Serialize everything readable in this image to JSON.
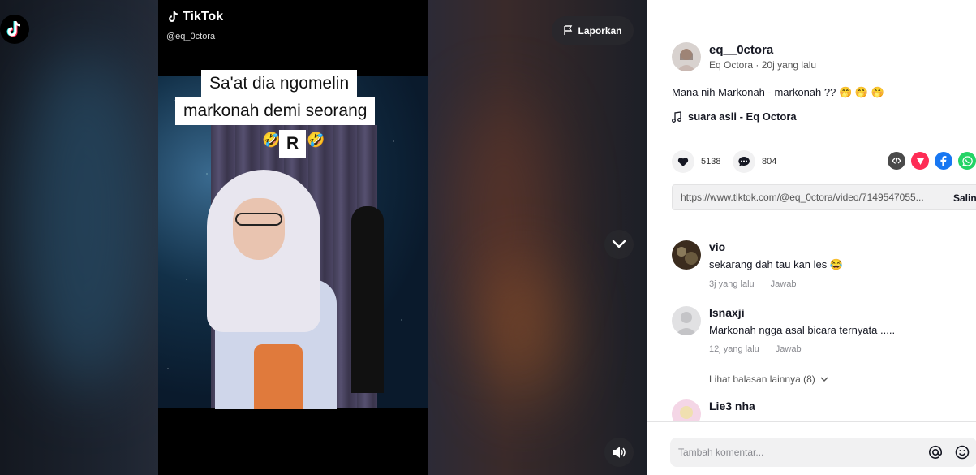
{
  "brand": {
    "name": "TikTok",
    "icon": "tiktok-logo-icon"
  },
  "video": {
    "watermark_brand": "TikTok",
    "watermark_handle": "@eq_0ctora",
    "caption_lines": [
      "Sa'at dia ngomelin",
      "markonah demi seorang",
      "R"
    ],
    "caption_emoji": "🤣",
    "report_label": "Laporkan"
  },
  "post": {
    "username": "eq__0ctora",
    "display_name": "Eq Octora",
    "time": "20j yang lalu",
    "description": "Mana nih Markonah - markonah ??",
    "description_emoji": "🤭 🤭 🤭",
    "music": "suara asli - Eq Octora",
    "likes": "5138",
    "comments_count": "804",
    "link": "https://www.tiktok.com/@eq_0ctora/video/7149547055...",
    "copy_label": "Salin"
  },
  "comments": [
    {
      "name": "vio",
      "text": "sekarang dah tau kan les",
      "emoji": "😂",
      "time": "3j yang lalu",
      "reply": "Jawab"
    },
    {
      "name": "Isnaxji",
      "text": "Markonah ngga asal bicara ternyata .....",
      "time": "12j yang lalu",
      "reply": "Jawab",
      "more_replies": "Lihat balasan lainnya (8)"
    },
    {
      "name": "Lie3 nha"
    }
  ],
  "input": {
    "placeholder": "Tambah komentar..."
  },
  "colors": {
    "accent": "#fe2c55",
    "facebook": "#1877f2",
    "whatsapp": "#25d366",
    "embed": "#4a4a4a"
  }
}
